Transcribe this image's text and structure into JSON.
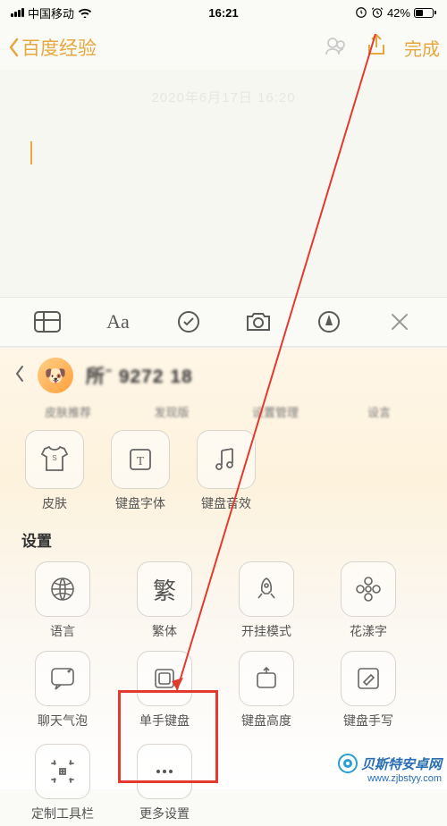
{
  "status": {
    "carrier": "中国移动",
    "time": "16:21",
    "battery": "42%"
  },
  "nav": {
    "back_label": "百度经验",
    "done_label": "完成"
  },
  "editor": {
    "date_faint": "2020年6月17日 16:20"
  },
  "keyboard": {
    "username_blur": "所ˉ 9272 18",
    "tabs_blur": [
      "皮肤推荐",
      "发现版",
      "设置管理",
      "设言"
    ],
    "row1": [
      {
        "id": "skin",
        "label": "皮肤"
      },
      {
        "id": "font",
        "label": "键盘字体"
      },
      {
        "id": "sound",
        "label": "键盘音效"
      }
    ],
    "section_title": "设置",
    "row2": [
      {
        "id": "lang",
        "label": "语言"
      },
      {
        "id": "trad",
        "label": "繁体"
      },
      {
        "id": "hack",
        "label": "开挂模式"
      },
      {
        "id": "flower",
        "label": "花漾字"
      }
    ],
    "row3": [
      {
        "id": "bubble",
        "label": "聊天气泡"
      },
      {
        "id": "onehand",
        "label": "单手键盘"
      },
      {
        "id": "height",
        "label": "键盘高度"
      },
      {
        "id": "handwrite",
        "label": "键盘手写"
      }
    ],
    "row4": [
      {
        "id": "customtb",
        "label": "定制工具栏"
      },
      {
        "id": "more",
        "label": "更多设置"
      }
    ]
  },
  "watermark": {
    "brand": "贝斯特安卓网",
    "url": "www.zjbstyy.com"
  }
}
